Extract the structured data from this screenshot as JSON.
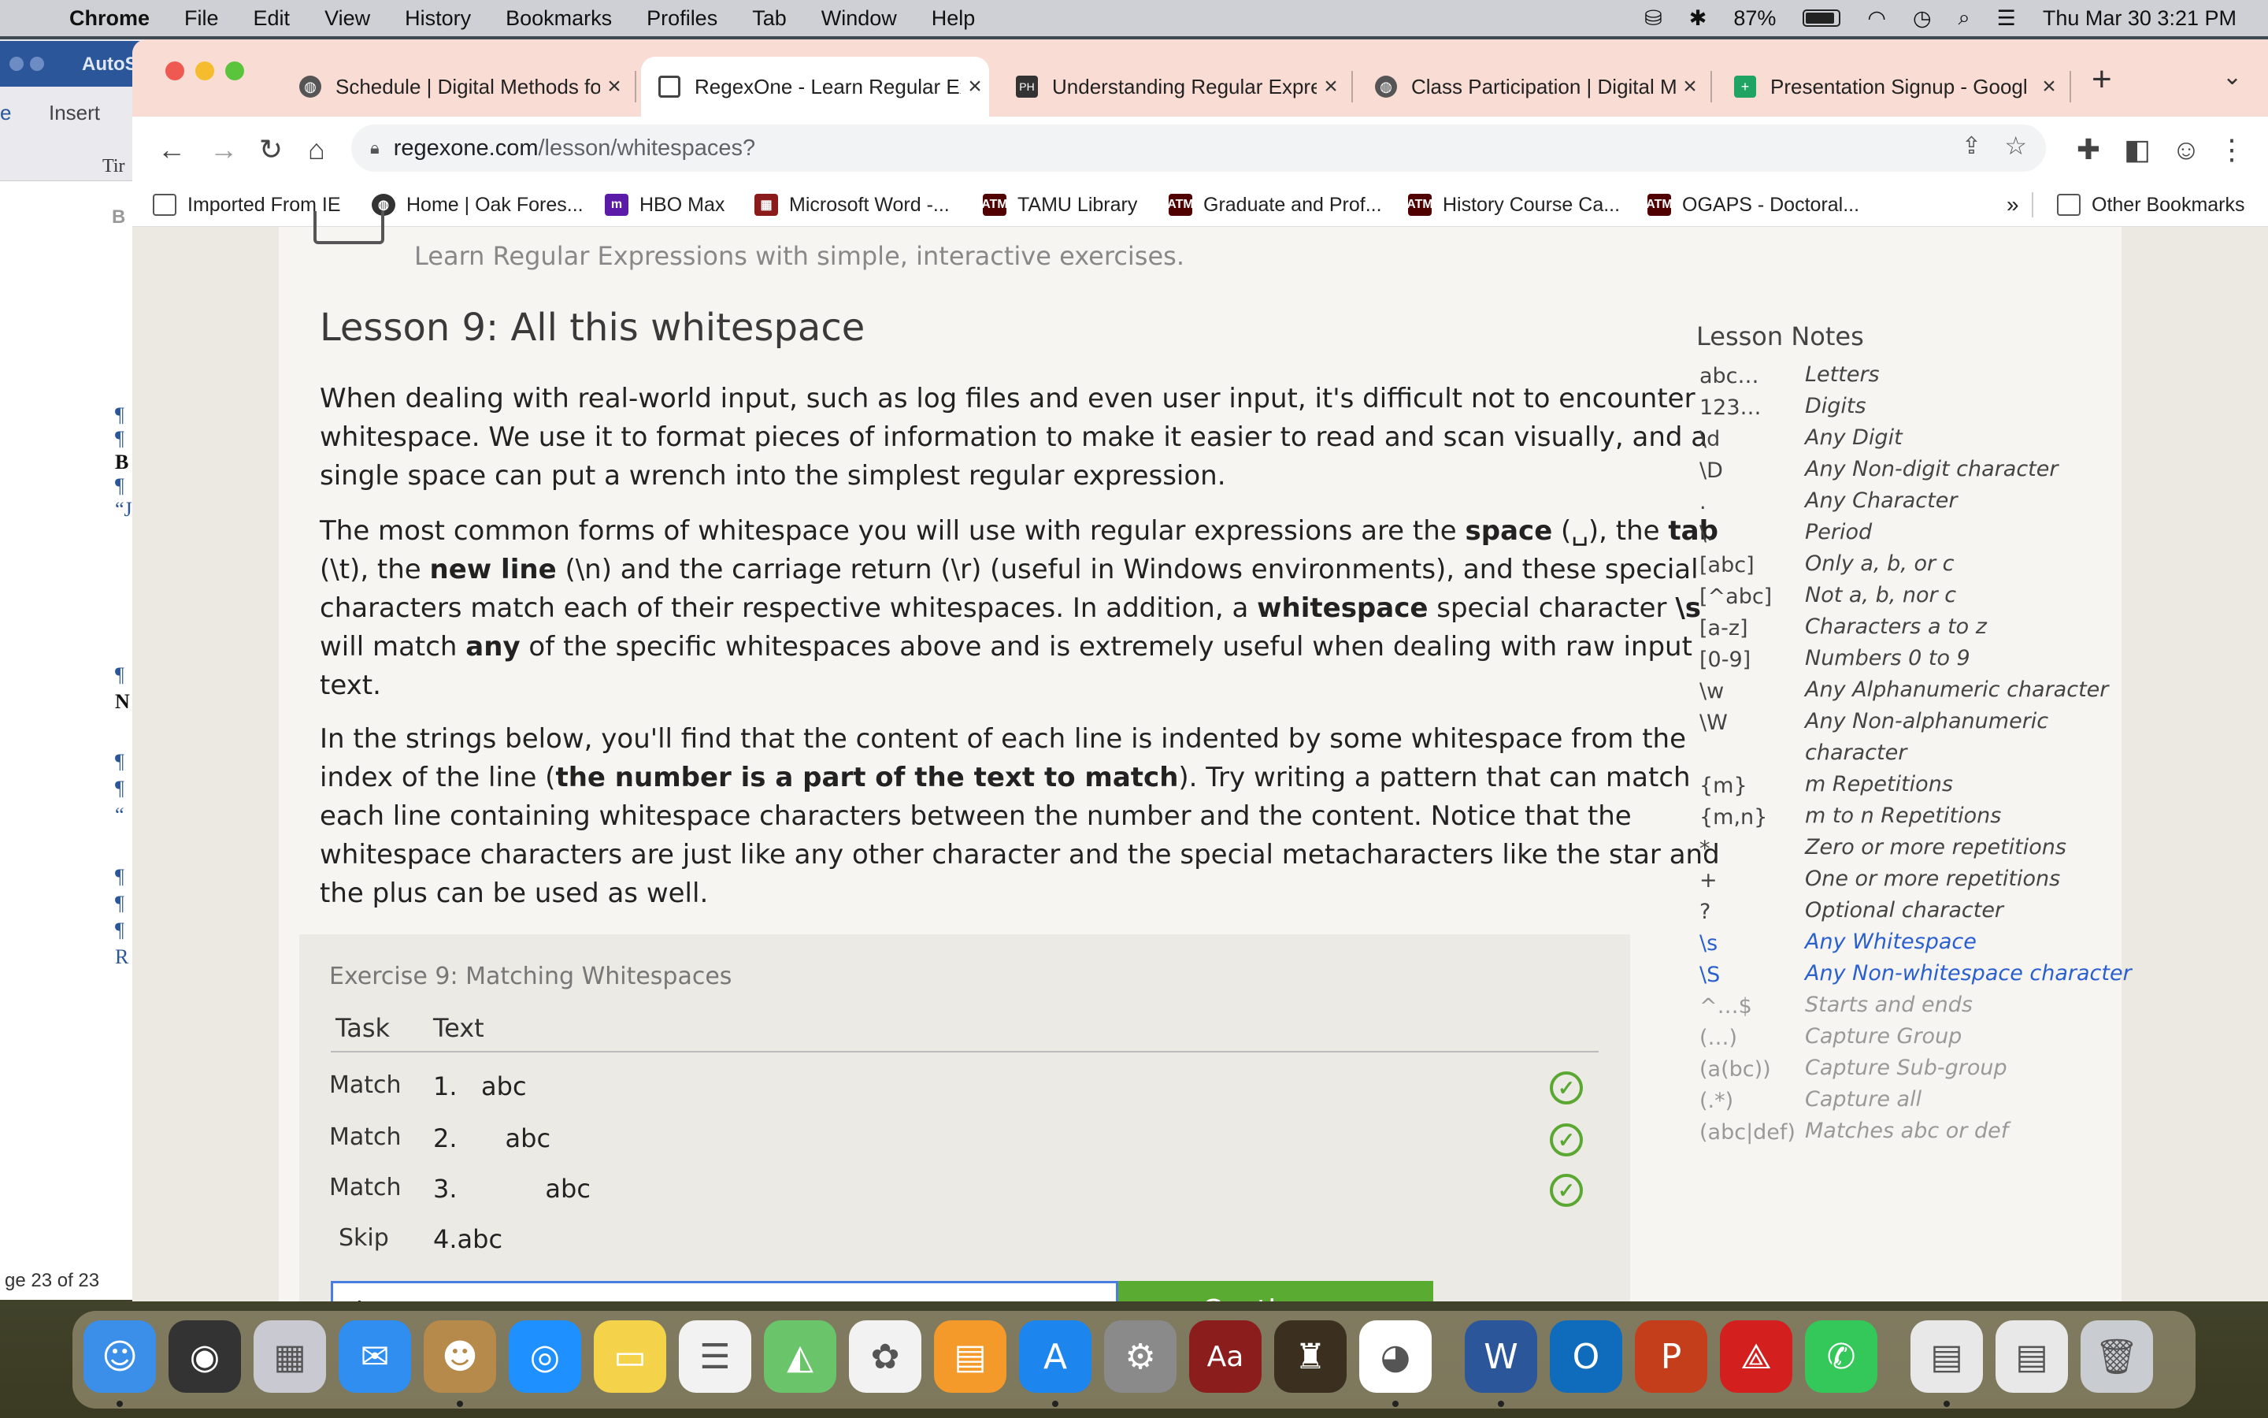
{
  "menubar": {
    "app": "Chrome",
    "items": [
      "File",
      "Edit",
      "View",
      "History",
      "Bookmarks",
      "Profiles",
      "Tab",
      "Window",
      "Help"
    ],
    "battery": "87%",
    "datetime": "Thu Mar 30  3:21 PM"
  },
  "word": {
    "title": "AutoS",
    "tab_home": "e",
    "tab_insert": "Insert",
    "font": "Tir",
    "status": "ge 23 of 23"
  },
  "tabs": [
    {
      "title": "Schedule | Digital Methods fo",
      "fav": "globe-icon"
    },
    {
      "title": "RegexOne - Learn Regular Ex",
      "fav": "regexone-icon"
    },
    {
      "title": "Understanding Regular Expre",
      "fav": "ph-icon"
    },
    {
      "title": "Class Participation | Digital M",
      "fav": "globe-icon"
    },
    {
      "title": "Presentation Signup - Googl",
      "fav": "sheets-icon"
    }
  ],
  "url": {
    "host": "regexone.com",
    "path": "/lesson/whitespaces?"
  },
  "bookmarks": [
    "Imported From IE",
    "Home | Oak Fores...",
    "HBO Max",
    "Microsoft Word -...",
    "TAMU Library",
    "Graduate and Prof...",
    "History Course Ca...",
    "OGAPS - Doctoral..."
  ],
  "bookmarks_more": "»",
  "other_bookmarks": "Other Bookmarks",
  "site_tagline": "Learn Regular Expressions with simple, interactive exercises.",
  "lesson": {
    "title": "Lesson 9: All this whitespace",
    "p1": "When dealing with real-world input, such as log files and even user input, it's difficult not to encounter whitespace. We use it to format pieces of information to make it easier to read and scan visually, and a single space can put a wrench into the simplest regular expression.",
    "p2": {
      "a": "The most common forms of whitespace you will use with regular expressions are the ",
      "space": "space",
      "b": " (␣), the ",
      "tab": "tab",
      "c": " (\\t), the ",
      "newline": "new line",
      "d": " (\\n) and the carriage return (\\r) (useful in Windows environments), and these special characters match each of their respective whitespaces. In addition, a ",
      "ws": "whitespace",
      "e": " special character ",
      "s": "\\s",
      "f": " will match ",
      "any": "any",
      "g": " of the specific whitespaces above and is extremely useful when dealing with raw input text."
    },
    "p3": {
      "a": "In the strings below, you'll find that the content of each line is indented by some whitespace from the index of the line (",
      "bold": "the number is a part of the text to match",
      "b": "). Try writing a pattern that can match each line containing whitespace characters between the number and the content. Notice that the whitespace characters are just like any other character and the special metacharacters like the star and the plus can be used as well."
    }
  },
  "exercise": {
    "title": "Exercise 9: Matching Whitespaces",
    "col_task": "Task",
    "col_text": "Text",
    "rows": [
      {
        "task": "Match",
        "text": "1.   abc",
        "ok": true
      },
      {
        "task": "Match",
        "text": "2.\t abc",
        "ok": true
      },
      {
        "task": "Match",
        "text": "3.           abc",
        "ok": true
      },
      {
        "task": "Skip",
        "text": "4.abc",
        "ok": false
      }
    ],
    "answer": "\\s",
    "continue": "Continue ›"
  },
  "notes": {
    "title": "Lesson Notes",
    "items": [
      {
        "k": "abc…",
        "v": "Letters",
        "s": ""
      },
      {
        "k": "123…",
        "v": "Digits",
        "s": ""
      },
      {
        "k": "\\d",
        "v": "Any Digit",
        "s": ""
      },
      {
        "k": "\\D",
        "v": "Any Non-digit character",
        "s": ""
      },
      {
        "k": ".",
        "v": "Any Character",
        "s": ""
      },
      {
        "k": "\\.",
        "v": "Period",
        "s": ""
      },
      {
        "k": "[abc]",
        "v": "Only a, b, or c",
        "s": ""
      },
      {
        "k": "[^abc]",
        "v": "Not a, b, nor c",
        "s": ""
      },
      {
        "k": "[a-z]",
        "v": "Characters a to z",
        "s": ""
      },
      {
        "k": "[0-9]",
        "v": "Numbers 0 to 9",
        "s": ""
      },
      {
        "k": "\\w",
        "v": "Any Alphanumeric character",
        "s": ""
      },
      {
        "k": "\\W",
        "v": "Any Non-alphanumeric character",
        "s": "wrap"
      },
      {
        "k": "{m}",
        "v": "m Repetitions",
        "s": ""
      },
      {
        "k": "{m,n}",
        "v": "m to n Repetitions",
        "s": ""
      },
      {
        "k": "*",
        "v": "Zero or more repetitions",
        "s": ""
      },
      {
        "k": "+",
        "v": "One or more repetitions",
        "s": ""
      },
      {
        "k": "?",
        "v": "Optional character",
        "s": ""
      },
      {
        "k": "\\s",
        "v": "Any Whitespace",
        "s": "hl"
      },
      {
        "k": "\\S",
        "v": "Any Non-whitespace character",
        "s": "hl"
      },
      {
        "k": "^…$",
        "v": "Starts and ends",
        "s": "dim"
      },
      {
        "k": "(…)",
        "v": "Capture Group",
        "s": "dim"
      },
      {
        "k": "(a(bc))",
        "v": "Capture Sub-group",
        "s": "dim"
      },
      {
        "k": "(.*)",
        "v": "Capture all",
        "s": "dim"
      },
      {
        "k": "(abc|def)",
        "v": "Matches abc or def",
        "s": "dim"
      }
    ]
  },
  "dock": [
    "finder-icon",
    "siri-icon",
    "launchpad-icon",
    "mail-icon",
    "contacts-icon",
    "safari-icon",
    "notes-icon",
    "reminders-icon",
    "maps-icon",
    "photos-icon",
    "books-icon",
    "appstore-icon",
    "settings-icon",
    "dictionary-icon",
    "medieval-icon",
    "chrome-icon",
    "word-icon",
    "outlook-icon",
    "powerpoint-icon",
    "acrobat-icon",
    "messages-icon",
    "doc1-icon",
    "doc2-icon",
    "trash-icon"
  ],
  "colors": {
    "accent": "#2a5fcf",
    "success": "#5aab32",
    "tabbar": "#f9dcd3"
  }
}
